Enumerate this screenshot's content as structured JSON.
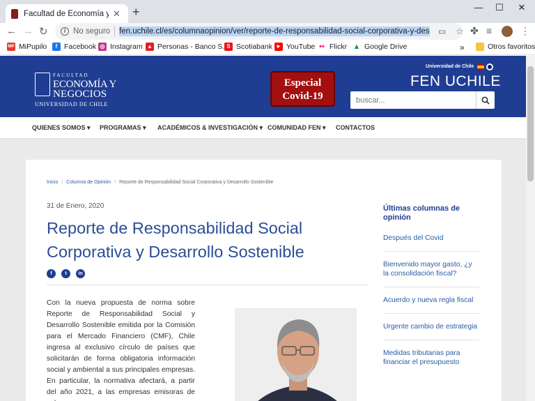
{
  "browser": {
    "tab_title": "Facultad de Economía y Negocios",
    "url": "fen.uchile.cl/es/columnaopinion/ver/reporte-de-responsabilidad-social-corporativa-y-desarrollo-sos",
    "security_label": "No seguro"
  },
  "bookmarks": [
    {
      "label": "MiPupilo",
      "color": "#e53935",
      "glyph": "MP"
    },
    {
      "label": "Facebook",
      "color": "#1877f2",
      "glyph": "f"
    },
    {
      "label": "Instagram",
      "color": "#c13584",
      "glyph": "◎"
    },
    {
      "label": "Personas - Banco S...",
      "color": "#e02020",
      "glyph": "▲"
    },
    {
      "label": "Scotiabank",
      "color": "#ec111a",
      "glyph": "S"
    },
    {
      "label": "YouTube",
      "color": "#ff0000",
      "glyph": "▶"
    },
    {
      "label": "Flickr",
      "color": "#ff0084",
      "glyph": "•"
    },
    {
      "label": "Google Drive",
      "color": "#0f9d58",
      "glyph": "▲"
    }
  ],
  "bookmarks_overflow": "»",
  "bookmarks_other": "Otros favoritos",
  "header": {
    "logo_line1": "FACULTAD",
    "logo_line2": "ECONOMÍA Y",
    "logo_line3": "NEGOCIOS",
    "logo_line4": "UNIVERSIDAD DE CHILE",
    "covid_line1": "Especial",
    "covid_line2": "Covid-19",
    "university": "Universidad de Chile",
    "site_name": "FEN UCHILE",
    "search_placeholder": "buscar..."
  },
  "menu": [
    "QUIENES SOMOS",
    "PROGRAMAS",
    "ACADÉMICOS & INVESTIGACIÓN",
    "COMUNIDAD FEN",
    "CONTACTOS"
  ],
  "breadcrumb": {
    "home": "Inicio",
    "section": "Columna de Opinión",
    "current": "Reporte de Responsabilidad Social Corporativa y Desarrollo Sostenible"
  },
  "article": {
    "date": "31 de Enero, 2020",
    "title": "Reporte de Responsabilidad Social Corporativa y Desarrollo Sostenible",
    "body": "Con la nueva propuesta de norma sobre Reporte de Responsabilidad Social y Desarrollo Sostenible emitida por la Comisión para el Mercado Financiero (CMF), Chile ingresa al exclusivo círculo de países que solicitarán de forma obligatoria información social y ambiental a sus principales empresas. En particular, la normativa afectará, a partir del año 2021, a las empresas emisoras de valores"
  },
  "sidebar": {
    "title": "Últimas columnas de opinión",
    "items": [
      "Después del Covid",
      "Bienvenido mayor gasto, ¿y la consolidación fiscal?",
      "Acuerdo y nueva regla fiscal",
      "Urgente cambio de estrategia",
      "Medidas tributarias para financiar el presupuesto"
    ]
  }
}
